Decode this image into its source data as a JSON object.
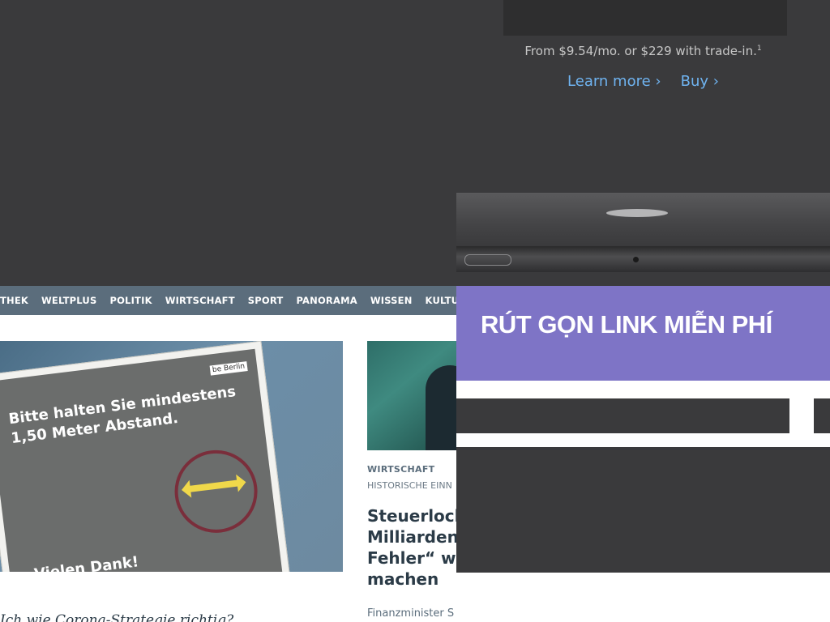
{
  "news": {
    "nav_items": [
      "THEK",
      "WELTPLUS",
      "POLITIK",
      "WIRTSCHAFT",
      "SPORT",
      "PANORAMA",
      "WISSEN",
      "KULTUR"
    ],
    "hero_image": {
      "sign_text_line1": "Bitte halten Sie mindestens",
      "sign_text_line2": "1,50 Meter Abstand.",
      "sign_footer": "Vielen Dank!",
      "sign_logo": "be Berlin"
    },
    "article": {
      "category": "WIRTSCHAFT",
      "subcategory": "HISTORISCHE EINN",
      "headline_line1": "Steuerloch",
      "headline_line2": "Milliarden –",
      "headline_line3": "Fehler“ wil",
      "headline_line4": "machen",
      "byline": "Finanzminister S"
    },
    "teaser_left": "Ich wie Corona-Strategie richtig?"
  },
  "promo": {
    "price_text": "From $9.54/mo. or $229 with trade-in.",
    "price_footnote": "1",
    "learn_more": "Learn more ›",
    "buy": "Buy ›"
  },
  "shortener": {
    "title": "RÚT GỌN LINK MIỄN PHÍ",
    "input_value": "",
    "submit_label": ""
  },
  "colors": {
    "nav_bg": "#5b6d7c",
    "banner_bg": "#7e74c6",
    "link_blue": "#6fb3f0",
    "dark_bg": "#3a3a3c"
  }
}
